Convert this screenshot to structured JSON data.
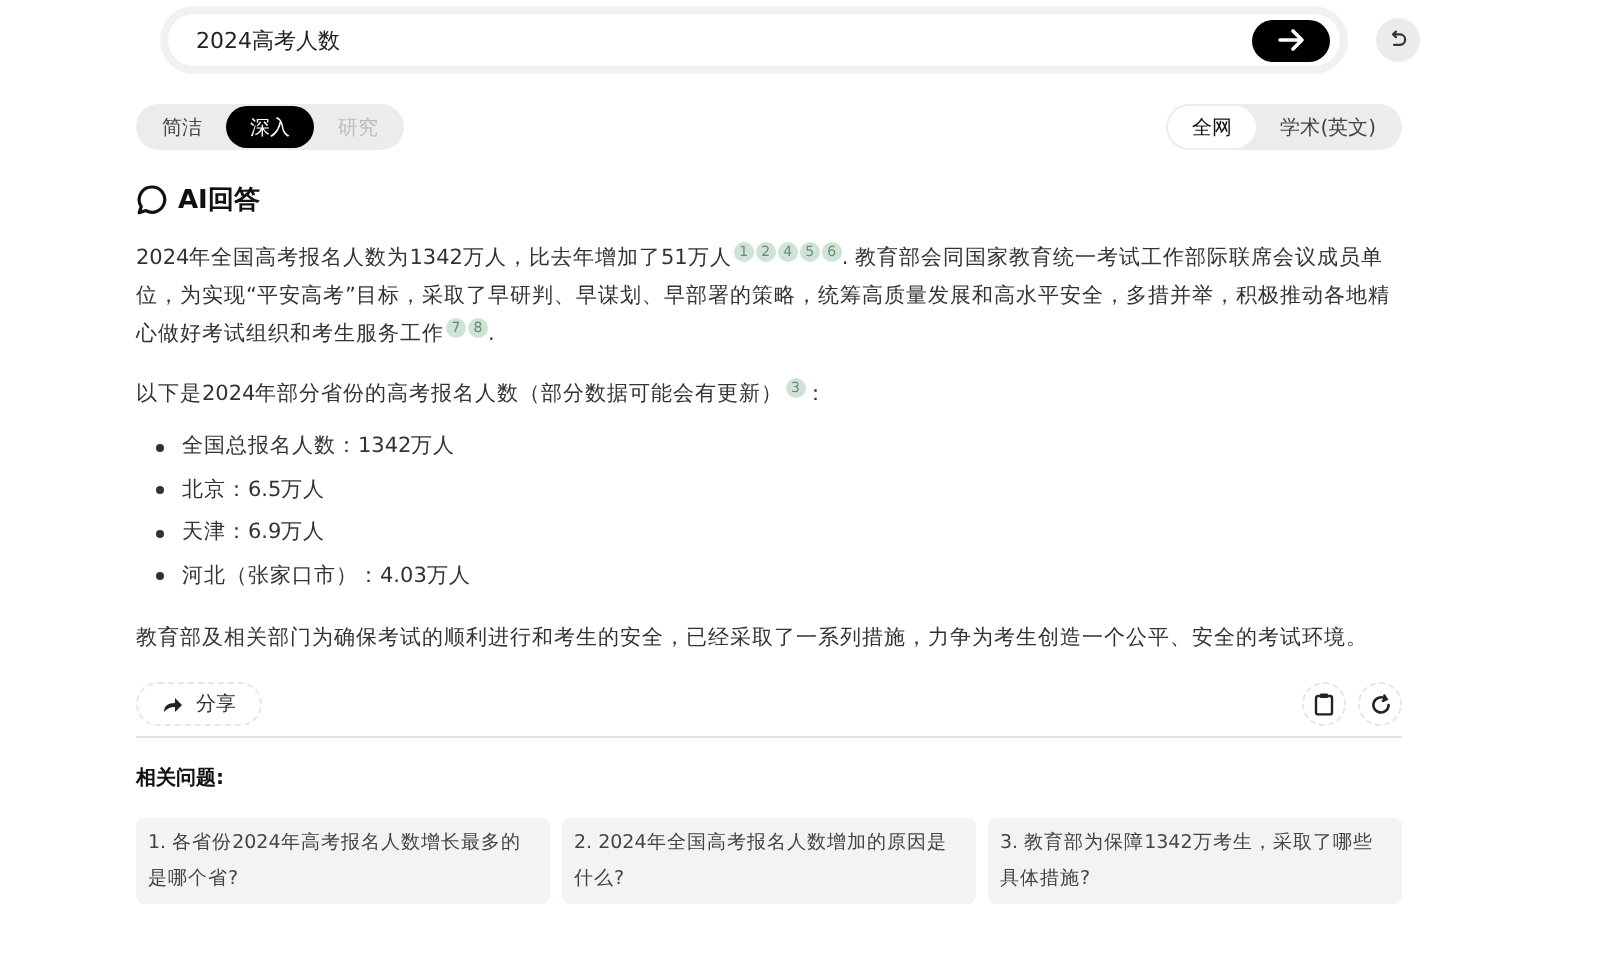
{
  "search": {
    "value": "2024高考人数"
  },
  "depth_modes": [
    {
      "label": "简洁",
      "selected": false,
      "disabled": false
    },
    {
      "label": "深入",
      "selected": true,
      "disabled": false
    },
    {
      "label": "研究",
      "selected": false,
      "disabled": true
    }
  ],
  "scope_modes": [
    {
      "label": "全网",
      "selected": true
    },
    {
      "label": "学术(英文)",
      "selected": false
    }
  ],
  "answer": {
    "title": "AI回答",
    "intro": [
      {
        "kind": "text",
        "text": "2024年全国高考报名人数为1342万人，比去年增加了51万人"
      },
      {
        "kind": "cite",
        "text": "1"
      },
      {
        "kind": "cite",
        "text": "2"
      },
      {
        "kind": "cite",
        "text": "4"
      },
      {
        "kind": "cite",
        "text": "5"
      },
      {
        "kind": "cite",
        "text": "6"
      },
      {
        "kind": "text",
        "text": ". 教育部会同国家教育统一考试工作部际联席会议成员单位，为实现“平安高考”目标，采取了早研判、早谋划、早部署的策略，统筹高质量发展和高水平安全，多措并举，积极推动各地精心做好考试组织和考生服务工作"
      },
      {
        "kind": "cite",
        "text": "7"
      },
      {
        "kind": "cite",
        "text": "8"
      },
      {
        "kind": "text",
        "text": "."
      }
    ],
    "list_intro": [
      {
        "kind": "text",
        "text": "以下是2024年部分省份的高考报名人数（部分数据可能会有更新）"
      },
      {
        "kind": "cite",
        "text": "3"
      },
      {
        "kind": "text",
        "text": "："
      }
    ],
    "bullets": [
      "全国总报名人数：1342万人",
      "北京：6.5万人",
      "天津：6.9万人",
      "河北（张家口市）：4.03万人"
    ],
    "conclusion": "教育部及相关部门为确保考试的顺利进行和考生的安全，已经采取了一系列措施，力争为考生创造一个公平、安全的考试环境。"
  },
  "share_button": "分享",
  "related": {
    "title": "相关问题:",
    "questions": [
      "1. 各省份2024年高考报名人数增长最多的是哪个省?",
      "2. 2024年全国高考报名人数增加的原因是什么?",
      "3. 教育部为保障1342万考生，采取了哪些具体措施?"
    ]
  }
}
